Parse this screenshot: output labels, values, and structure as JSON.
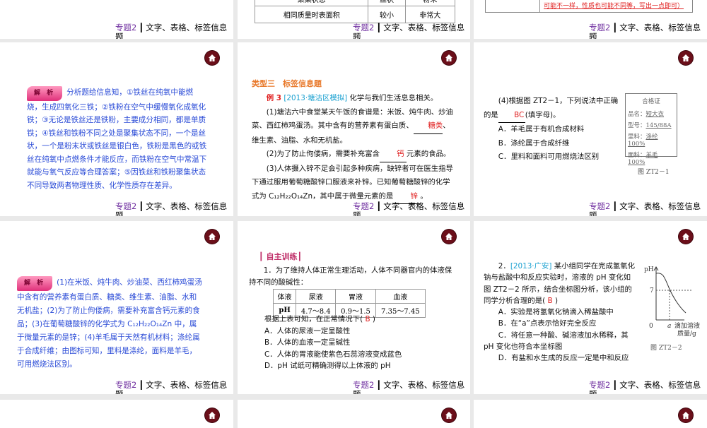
{
  "footer": {
    "topic": "专题2",
    "title": "文字、表格、标签信息题"
  },
  "top": {
    "table": [
      [
        "聚集状态",
        "丝状",
        "粉末"
      ],
      [
        "相同质量时表面积",
        "较小",
        "非常大"
      ]
    ],
    "red_note": "可能不一样，性质也可能不同等，写出一点即可）"
  },
  "p1": {
    "badge": "解 析",
    "text": "分析题给信息知，①铁丝在纯氧中能燃烧，生成四氧化三铁；②铁粉在空气中缓慢氧化成氧化铁；③无论是铁丝还是铁粉，主要成分相同，都是单质铁；④铁丝和铁粉不同之处是聚集状态不同，一个是丝状，一个是粉末状或铁丝是银白色，铁粉是黑色的或铁丝在纯氧中点燃条件才能反应，而铁粉在空气中常温下就能与氧气反应等合理答案；⑤因铁丝和铁粉聚集状态不同导致两者物理性质、化学性质存在差异。"
  },
  "p2": {
    "heading": "类型三　标签信息题",
    "ex": "例 3",
    "src": "[2013·塘沽区模拟]",
    "intro": "化学与我们生活息息相关。",
    "q1a": "(1)塘沽六中食堂某天午饭的食谱是：米饭、炖牛肉、炒油菜、西红柿鸡蛋汤。其中含有的营养素有蛋白质、",
    "a1": "糖类",
    "q1b": "、维生素、油脂、水和无机盐。",
    "q2a": "(2)为了防止佝偻病，需要补充富含",
    "a2": "钙",
    "q2b": "元素的食品。",
    "q3a": "(3)人体摄入锌不足会引起多种疾病，缺锌者可在医生指导下通过服用葡萄糖酸锌口服液来补锌。已知葡萄糖酸锌的化学式为 C₁₂H₂₂O₁₄Zn，其中属于微量元素的是",
    "a3": "锌",
    "q3b": "。"
  },
  "p3": {
    "q4a": "(4)根据图 ZT2－1，下列说法中正确的是",
    "a4": "BC",
    "q4b": "(填字母)。",
    "opts": [
      "A．羊毛属于有机合成材料",
      "B．涤纶属于合成纤维",
      "C．里料和面料可用燃烧法区别"
    ],
    "cert": {
      "title": "合格证",
      "rows": [
        [
          "品名：",
          "短大衣"
        ],
        [
          "型号：",
          "145/88A"
        ],
        [
          "里料：",
          "涤纶100%"
        ],
        [
          "面料：",
          "羊毛100%"
        ]
      ]
    },
    "caption": "图 ZT2－1"
  },
  "p4": {
    "badge": "解 析",
    "text": "(1)在米饭、炖牛肉、炒油菜、西红柿鸡蛋汤中含有的营养素有蛋白质、糖类、维生素、油脂、水和无机盐；(2)为了防止佝偻病，需要补充富含钙元素的食品；(3)在葡萄糖酸锌的化学式为 C₁₂H₂₂O₁₄Zn 中，属于微量元素的是锌；(4)羊毛属于天然有机材料；涤纶属于合成纤维；由图标可知，里料是涤纶，面料是羊毛，可用燃烧法区别。"
  },
  "p5": {
    "heading": "自主训练",
    "q": "1．为了维持人体正常生理活动，人体不同器官内的体液保持不同的酸碱性：",
    "table": [
      [
        "体液",
        "尿液",
        "胃液",
        "血液"
      ],
      [
        "pH",
        "4.7～8.4",
        "0.9～1.5",
        "7.35～7.45"
      ]
    ],
    "ask": "根据上表可知，在正常情况下(",
    "ans": "B",
    "close": ")",
    "opts": [
      "A．人体的尿液一定呈酸性",
      "B．人体的血液一定呈碱性",
      "C．人体的胃液能使紫色石蕊溶液变成蓝色",
      "D．pH 试纸可精确测得以上体液的 pH"
    ]
  },
  "p6": {
    "num": "2．",
    "src": "[2013·广安]",
    "q": "某小组同学在完成氢氧化钠与盐酸中和反应实验时，溶液的 pH 变化如图 ZT2－2 所示，结合坐标图分析，该小组的同学分析合理的是(",
    "ans": "B",
    "close": ")",
    "opts": [
      "A．实验是将氢氧化钠滴入稀盐酸中",
      "B．在“a”点表示恰好完全反应",
      "C．将任意一种酸、碱溶液加水稀释，其 pH 变化也符合本坐标图",
      "D．有盐和水生成的反应一定是中和反应"
    ],
    "chart": {
      "ylabel": "pH",
      "y7": "7",
      "origin": "0",
      "xa": "a",
      "xlabel1": "滴加溶液",
      "xlabel2": "质量/g"
    },
    "caption": "图 ZT2－2"
  }
}
